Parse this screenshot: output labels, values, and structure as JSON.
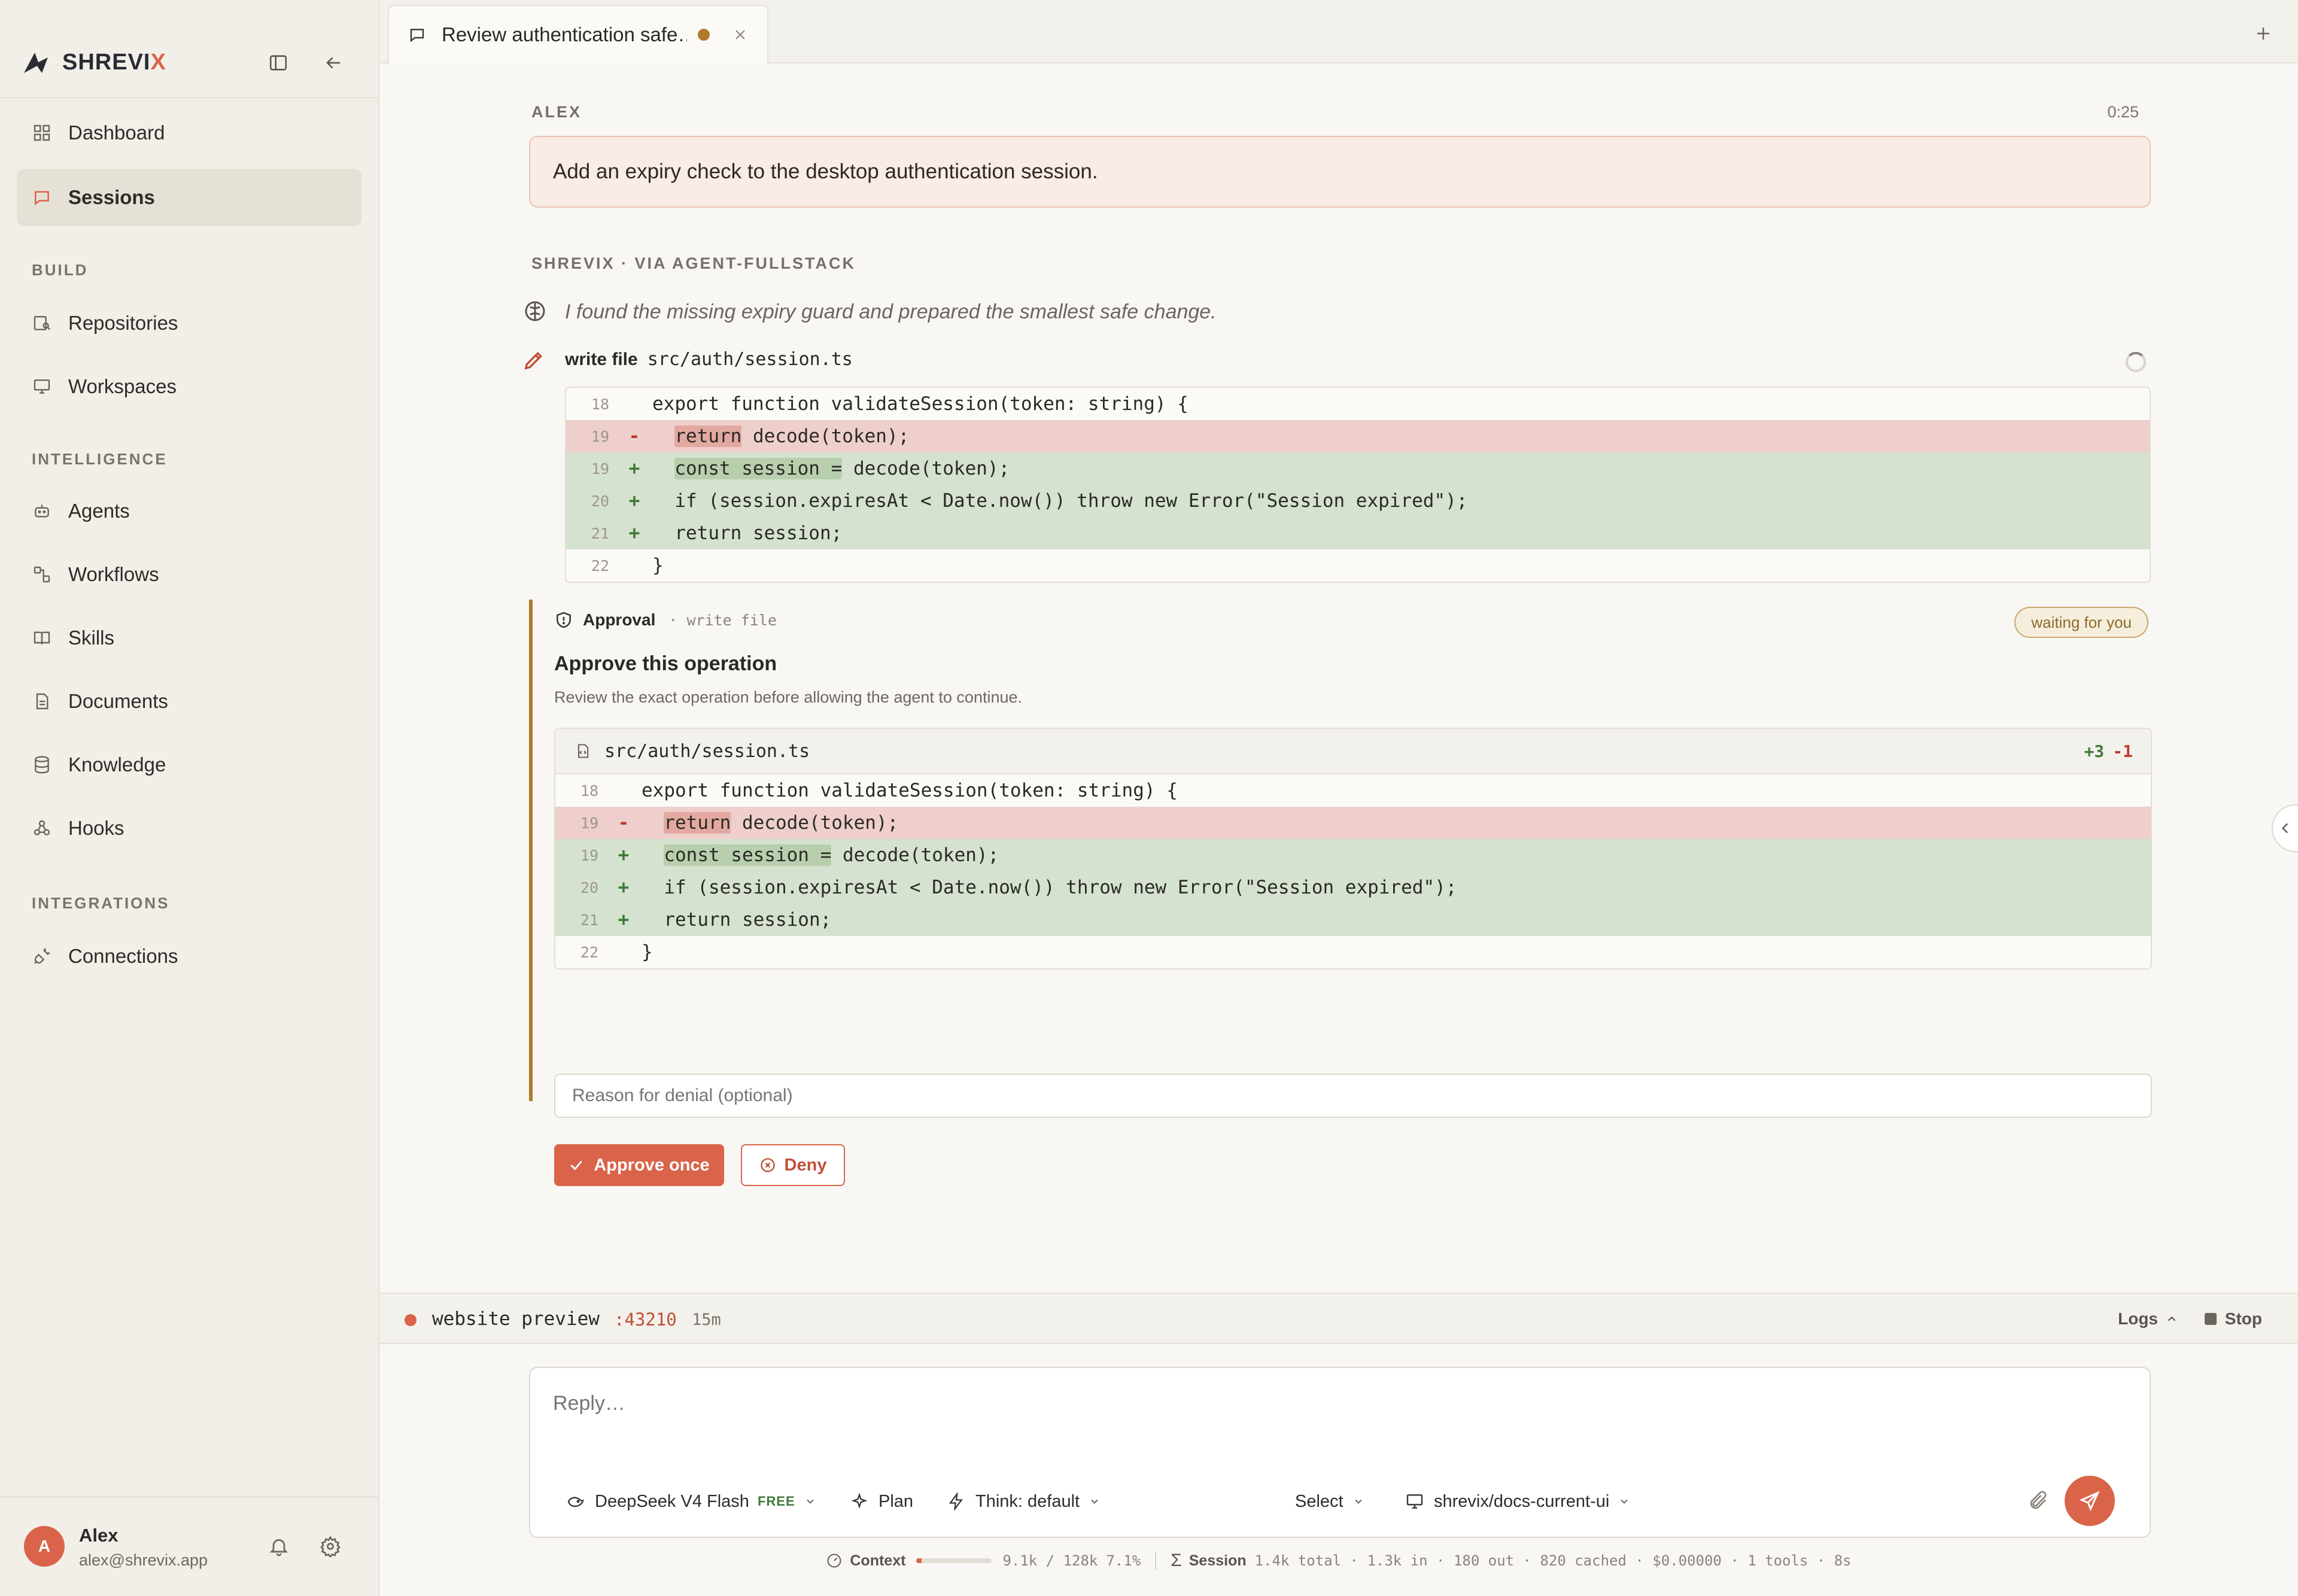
{
  "brand": {
    "name_main": "SHREVI",
    "name_accent": "X"
  },
  "sidebar": {
    "items": [
      {
        "label": "Dashboard",
        "icon": "dashboard-icon"
      },
      {
        "label": "Sessions",
        "icon": "chat-icon",
        "active": true
      }
    ],
    "sections": [
      {
        "title": "BUILD",
        "items": [
          {
            "label": "Repositories",
            "icon": "repo-icon"
          },
          {
            "label": "Workspaces",
            "icon": "monitor-icon"
          }
        ]
      },
      {
        "title": "INTELLIGENCE",
        "items": [
          {
            "label": "Agents",
            "icon": "bot-icon"
          },
          {
            "label": "Workflows",
            "icon": "workflow-icon"
          },
          {
            "label": "Skills",
            "icon": "book-icon"
          },
          {
            "label": "Documents",
            "icon": "document-icon"
          },
          {
            "label": "Knowledge",
            "icon": "database-icon"
          },
          {
            "label": "Hooks",
            "icon": "webhook-icon"
          }
        ]
      },
      {
        "title": "INTEGRATIONS",
        "items": [
          {
            "label": "Connections",
            "icon": "plug-icon"
          }
        ]
      }
    ],
    "user": {
      "initial": "A",
      "name": "Alex",
      "email": "alex@shrevix.app"
    }
  },
  "tab": {
    "title": "Review authentication safe…"
  },
  "conversation": {
    "user_role": "ALEX",
    "user_time": "0:25",
    "user_message": "Add an expiry check to the desktop authentication session.",
    "agent_role": "SHREVIX · VIA AGENT-FULLSTACK",
    "thought": "I found the missing expiry guard and prepared the smallest safe change.",
    "write_label": "write file",
    "write_path": "src/auth/session.ts"
  },
  "diff": {
    "lines": [
      {
        "n": "18",
        "sign": " ",
        "type": "ctx",
        "pre": "",
        "hl": "",
        "post": "export function validateSession(token: string) {"
      },
      {
        "n": "19",
        "sign": "-",
        "type": "del",
        "pre": "  ",
        "hl": "return",
        "post": " decode(token);"
      },
      {
        "n": "19",
        "sign": "+",
        "type": "add",
        "pre": "  ",
        "hl": "const session =",
        "post": " decode(token);"
      },
      {
        "n": "20",
        "sign": "+",
        "type": "add",
        "pre": "  ",
        "hl": "",
        "post": "if (session.expiresAt < Date.now()) throw new Error(\"Session expired\");"
      },
      {
        "n": "21",
        "sign": "+",
        "type": "add",
        "pre": "  ",
        "hl": "",
        "post": "return session;"
      },
      {
        "n": "22",
        "sign": " ",
        "type": "ctx",
        "pre": "",
        "hl": "",
        "post": "}"
      }
    ]
  },
  "approval": {
    "title_label": "Approval",
    "op": "· write file",
    "status": "waiting for you",
    "heading": "Approve this operation",
    "subtext": "Review the exact operation before allowing the agent to continue.",
    "file": "src/auth/session.ts",
    "added": "+3",
    "removed": "-1",
    "reason_placeholder": "Reason for denial (optional)",
    "approve_label": "Approve once",
    "deny_label": "Deny"
  },
  "preview": {
    "name": "website preview",
    "port": ":43210",
    "uptime": "15m",
    "logs_label": "Logs",
    "stop_label": "Stop"
  },
  "composer": {
    "placeholder": "Reply…",
    "model": "DeepSeek V4 Flash",
    "model_badge": "FREE",
    "plan": "Plan",
    "think": "Think: default",
    "select": "Select",
    "workspace": "shrevix/docs-current-ui"
  },
  "status": {
    "context_label": "Context",
    "context_fraction": 0.071,
    "context_value": "9.1k / 128k",
    "context_pct": "7.1%",
    "session_label": "Session",
    "session_stats": "1.4k total · 1.3k in · 180 out · 820 cached · $0.00000 · 1 tools · 8s"
  },
  "colors": {
    "accent": "#d9644a",
    "approval_border": "#b07a2b",
    "add_bg": "#d5e2cf",
    "del_bg": "#eecfcb"
  }
}
